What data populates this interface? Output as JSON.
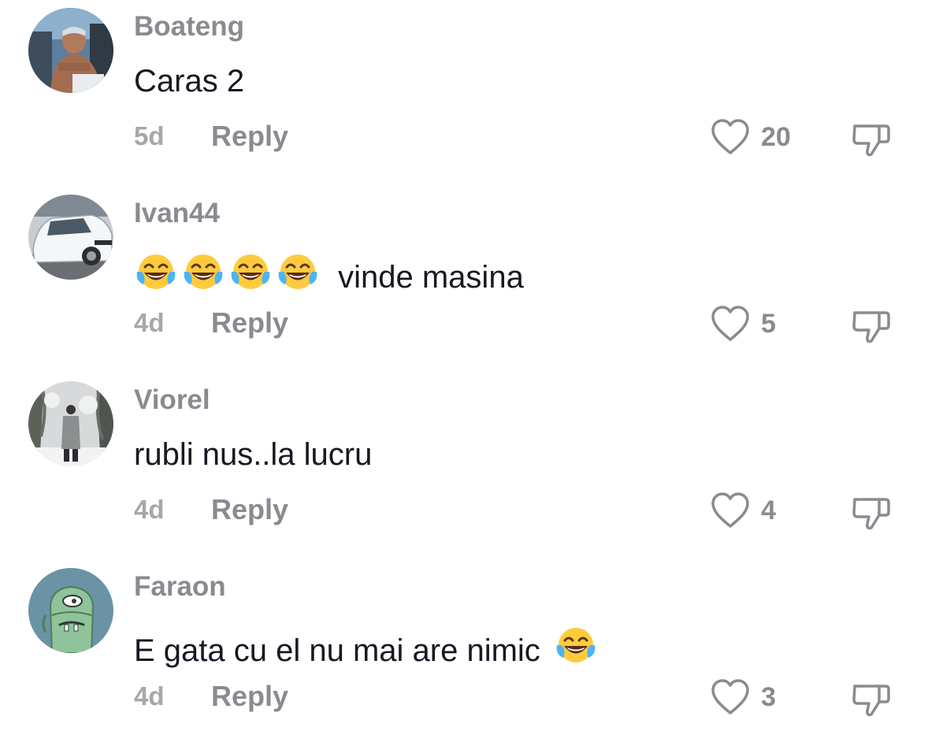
{
  "comments": [
    {
      "username": "Boateng",
      "text": "Caras 2",
      "emoji_count": 0,
      "emoji_after": 0,
      "time": "5d",
      "reply_label": "Reply",
      "likes": "20",
      "avatar": "man-shirtless-photo"
    },
    {
      "username": "Ivan44",
      "text": "vinde masina",
      "emoji_count": 4,
      "emoji_after": 0,
      "time": "4d",
      "reply_label": "Reply",
      "likes": "5",
      "avatar": "white-car-photo"
    },
    {
      "username": "Viorel",
      "text": "rubli nus..la lucru",
      "emoji_count": 0,
      "emoji_after": 0,
      "time": "4d",
      "reply_label": "Reply",
      "likes": "4",
      "avatar": "snowy-forest-person-photo"
    },
    {
      "username": "Faraon",
      "text": "E gata cu el nu mai are nimic",
      "emoji_count": 0,
      "emoji_after": 1,
      "time": "4d",
      "reply_label": "Reply",
      "likes": "3",
      "avatar": "green-cartoon-character"
    }
  ],
  "icons": {
    "like": "heart-outline-icon",
    "dislike": "thumbs-down-outline-icon",
    "emoji": "face-with-tears-of-joy-emoji"
  },
  "colors": {
    "username": "#8a8b91",
    "text": "#161823",
    "meta": "#a6a7ab",
    "icon": "#8a8b91"
  }
}
